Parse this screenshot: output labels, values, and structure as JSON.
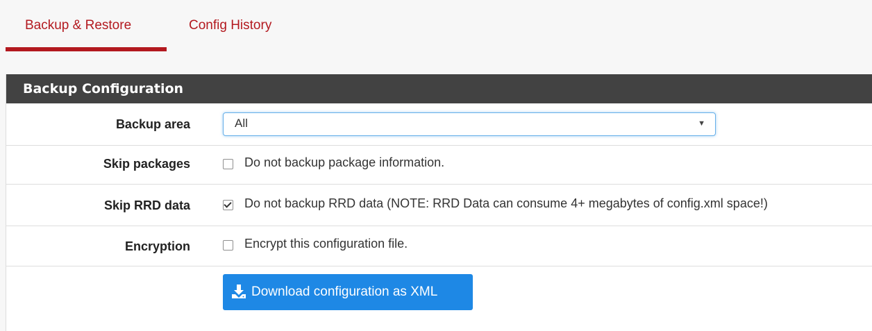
{
  "tabs": [
    {
      "label": "Backup & Restore",
      "active": true
    },
    {
      "label": "Config History",
      "active": false
    }
  ],
  "panel": {
    "title": "Backup Configuration",
    "backup_area": {
      "label": "Backup area",
      "value": "All"
    },
    "skip_packages": {
      "label": "Skip packages",
      "text": "Do not backup package information.",
      "checked": false
    },
    "skip_rrd": {
      "label": "Skip RRD data",
      "text": "Do not backup RRD data (NOTE: RRD Data can consume 4+ megabytes of config.xml space!)",
      "checked": true
    },
    "encryption": {
      "label": "Encryption",
      "text": "Encrypt this configuration file.",
      "checked": false
    },
    "download_button": {
      "label": "Download configuration as XML",
      "icon": "download-icon"
    }
  },
  "colors": {
    "accent": "#b3191f",
    "heading_bg": "#424242",
    "button_bg": "#1e88e5"
  }
}
